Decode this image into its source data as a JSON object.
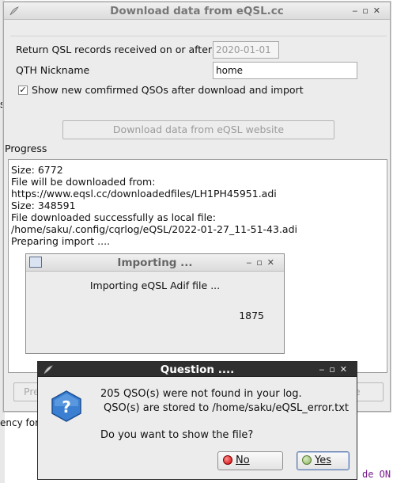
{
  "background": {
    "fragment_left": "ency for",
    "fragment_right": "de ON"
  },
  "main_window": {
    "title": "Download data from eQSL.cc",
    "buttons": [
      "‒",
      "▫",
      "✕"
    ],
    "return_label": "Return QSL records received on or after",
    "return_value": "2020-01-01",
    "qth_label": "QTH Nickname",
    "qth_value": "home",
    "show_checked": "✓",
    "show_label": "Show new comfirmed QSOs after download and import",
    "download_button": "Download data from eQSL website",
    "progress_label": "Progress",
    "log_lines": [
      "Size: 6772",
      "File will be downloaded from:",
      "https://www.eqsl.cc/downloadedfiles/LH1PH45951.adi",
      "Size: 348591",
      "File downloaded successfully as local file:",
      "/home/saku/.config/cqrlog/eQSL/2022-01-27_11-51-43.adi",
      "Preparing import ...."
    ],
    "bottom_left_partial": "Pre",
    "bottom_right_partial": "e"
  },
  "import_dialog": {
    "title": "Importing ...",
    "message": "Importing eQSL Adif file ...",
    "count": "1875"
  },
  "question_dialog": {
    "title": "Question ....",
    "line1": "205 QSO(s) were not found in your log.",
    "line2": "QSO(s) are stored to /home/saku/eQSL_error.txt",
    "line3": "Do you want to show the file?",
    "no_label": "No",
    "yes_label": "Yes"
  }
}
